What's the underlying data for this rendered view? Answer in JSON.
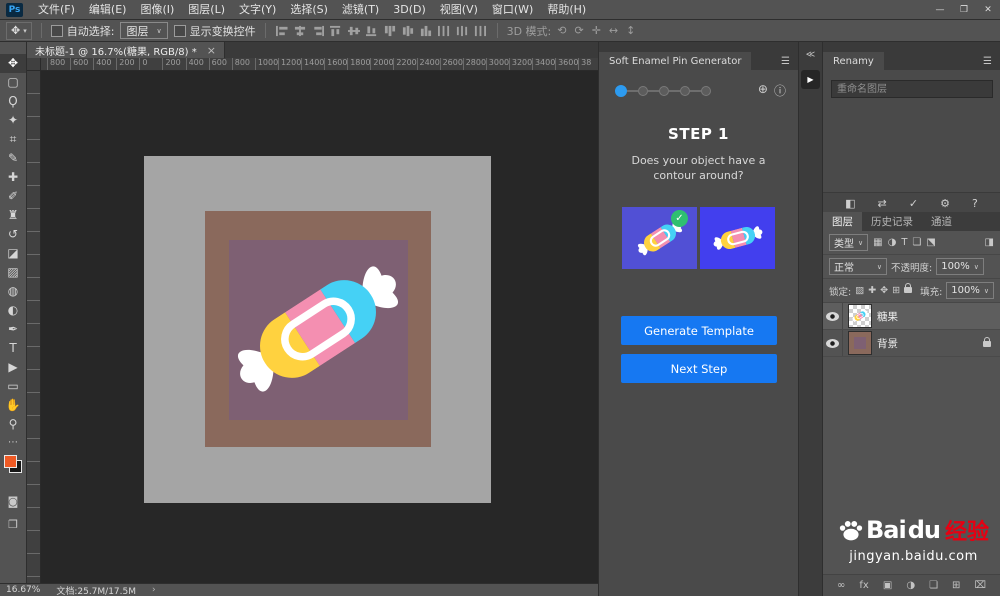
{
  "colors": {
    "accent_blue": "#1678f2",
    "step_active_blue": "#2d9bf0",
    "candy_yellow": "#ffd23f",
    "candy_pink": "#f48fb1",
    "candy_cyan": "#45d1f5",
    "foreground_swatch": "#ef5a24",
    "thumb_left_bg": "#5150d5",
    "thumb_right_bg": "#423fee",
    "baidu_red": "#e60012"
  },
  "menu_bar": {
    "logo": "Ps",
    "items": [
      "文件(F)",
      "编辑(E)",
      "图像(I)",
      "图层(L)",
      "文字(Y)",
      "选择(S)",
      "滤镜(T)",
      "3D(D)",
      "视图(V)",
      "窗口(W)",
      "帮助(H)"
    ],
    "controls": [
      {
        "name": "minimize",
        "glyph": "—"
      },
      {
        "name": "maximize",
        "glyph": "❐"
      },
      {
        "name": "close",
        "glyph": "✕"
      }
    ]
  },
  "options_bar": {
    "tool_glyph": "✥",
    "auto_select_label": "自动选择:",
    "auto_select_value": "图层",
    "show_transform_label": "显示变换控件",
    "mode_3d_label": "3D 模式:",
    "align_icons": [
      "align-left",
      "align-hcenter",
      "align-right",
      "align-top",
      "align-vcenter",
      "align-bottom",
      "distribute-top",
      "distribute-vcenter",
      "distribute-bottom",
      "distribute-left",
      "distribute-hcenter",
      "distribute-right"
    ],
    "mode_3d_icons": [
      {
        "name": "3d-orbit",
        "glyph": "⟲"
      },
      {
        "name": "3d-roll",
        "glyph": "⟳"
      },
      {
        "name": "3d-pan",
        "glyph": "✛"
      },
      {
        "name": "3d-slide",
        "glyph": "↔"
      },
      {
        "name": "3d-scale",
        "glyph": "↕"
      }
    ]
  },
  "document_tab": {
    "title": "未标题-1 @ 16.7%(糖果, RGB/8) *",
    "close_glyph": "×"
  },
  "ruler_labels": [
    "800",
    "600",
    "400",
    "200",
    "0",
    "200",
    "400",
    "600",
    "800",
    "1000",
    "1200",
    "1400",
    "1600",
    "1800",
    "2000",
    "2200",
    "2400",
    "2600",
    "2800",
    "3000",
    "3200",
    "3400",
    "3600",
    "38"
  ],
  "toolbar": {
    "tools": [
      {
        "name": "move-tool",
        "glyph": "✥"
      },
      {
        "name": "marquee-tool",
        "glyph": "▢"
      },
      {
        "name": "lasso-tool",
        "glyph": "Ϙ"
      },
      {
        "name": "quick-selection-tool",
        "glyph": "✦"
      },
      {
        "name": "crop-tool",
        "glyph": "⌗"
      },
      {
        "name": "eyedropper-tool",
        "glyph": "✎"
      },
      {
        "name": "healing-brush-tool",
        "glyph": "✚"
      },
      {
        "name": "brush-tool",
        "glyph": "✐"
      },
      {
        "name": "clone-stamp-tool",
        "glyph": "♜"
      },
      {
        "name": "history-brush-tool",
        "glyph": "↺"
      },
      {
        "name": "eraser-tool",
        "glyph": "◪"
      },
      {
        "name": "gradient-tool",
        "glyph": "▨"
      },
      {
        "name": "blur-tool",
        "glyph": "◍"
      },
      {
        "name": "dodge-tool",
        "glyph": "◐"
      },
      {
        "name": "pen-tool",
        "glyph": "✒"
      },
      {
        "name": "type-tool",
        "glyph": "T"
      },
      {
        "name": "path-selection-tool",
        "glyph": "▶"
      },
      {
        "name": "rectangle-tool",
        "glyph": "▭"
      },
      {
        "name": "hand-tool",
        "glyph": "✋"
      },
      {
        "name": "zoom-tool",
        "glyph": "⚲"
      }
    ],
    "edit_toolbar_glyph": "⋯",
    "quick_mask_glyph": "◙",
    "screen_mode_glyph": "❐"
  },
  "extension_panel": {
    "title": "Soft Enamel Pin Generator",
    "menu_glyph": "☰",
    "total_steps": 5,
    "active_step": 1,
    "globe_glyph": "⊕",
    "info_glyph": "ⓘ",
    "step_heading": "STEP 1",
    "question": [
      "Does your object have a",
      "contour around?"
    ],
    "check_glyph": "✓",
    "generate_button": "Generate Template",
    "next_button": "Next Step"
  },
  "dock_strip": {
    "collapse_glyph": "≪",
    "play_glyph": "▶"
  },
  "renamy_panel": {
    "title": "Renamy",
    "menu_glyph": "☰",
    "input_placeholder": "重命名图层",
    "action_icons": [
      {
        "name": "selection-scope-icon",
        "glyph": "◧"
      },
      {
        "name": "swap-icon",
        "glyph": "⇄"
      },
      {
        "name": "confirm-icon",
        "glyph": "✓"
      },
      {
        "name": "settings-icon",
        "glyph": "⚙"
      },
      {
        "name": "help-icon",
        "glyph": "?"
      }
    ]
  },
  "layers_panel": {
    "tabs": [
      "图层",
      "历史记录",
      "通道"
    ],
    "filter_label": "类型",
    "filter_icons": [
      {
        "name": "filter-pixel-icon",
        "glyph": "▦"
      },
      {
        "name": "filter-adjustment-icon",
        "glyph": "◑"
      },
      {
        "name": "filter-type-icon",
        "glyph": "T"
      },
      {
        "name": "filter-shape-icon",
        "glyph": "❏"
      },
      {
        "name": "filter-smart-object-icon",
        "glyph": "⬔"
      }
    ],
    "filter_switch_glyph": "◨",
    "blend_mode": "正常",
    "opacity_label": "不透明度:",
    "opacity_value": "100%",
    "lock_label": "锁定:",
    "lock_icons": [
      {
        "name": "lock-transparent-icon",
        "glyph": "▨"
      },
      {
        "name": "lock-pixels-icon",
        "glyph": "✚"
      },
      {
        "name": "lock-position-icon",
        "glyph": "✥"
      },
      {
        "name": "lock-artboard-icon",
        "glyph": "⊞"
      }
    ],
    "fill_label": "填充:",
    "fill_value": "100%",
    "layers": [
      {
        "name": "糖果",
        "selected": true,
        "locked": false
      },
      {
        "name": "背景",
        "selected": false,
        "locked": true
      }
    ],
    "bottom_icons": [
      {
        "name": "link-layers-icon",
        "glyph": "∞"
      },
      {
        "name": "layer-effects-icon",
        "glyph": "fx"
      },
      {
        "name": "layer-mask-icon",
        "glyph": "▣"
      },
      {
        "name": "adjustment-layer-icon",
        "glyph": "◑"
      },
      {
        "name": "layer-group-icon",
        "glyph": "❏"
      },
      {
        "name": "new-layer-icon",
        "glyph": "⊞"
      },
      {
        "name": "delete-layer-icon",
        "glyph": "⌧"
      }
    ]
  },
  "status_bar": {
    "zoom": "16.67%",
    "doc_info": "文档:25.7M/17.5M",
    "chevron": "›"
  },
  "watermark": {
    "text_bai": "Bai",
    "text_du": "du",
    "text_cn": "经验",
    "url": "jingyan.baidu.com"
  }
}
